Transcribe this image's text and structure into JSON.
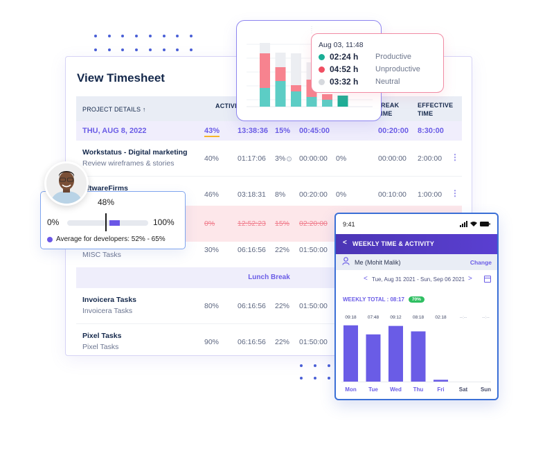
{
  "timesheet": {
    "title": "View Timesheet",
    "headers": {
      "project_details": "PROJECT DETAILS ↑",
      "activity": "ACTIVI",
      "break_time_line1": "REAK",
      "break_time_line2": "IME",
      "effective_line1": "EFFECTIVE",
      "effective_line2": "TIME"
    },
    "date_row": {
      "date": "THU, AUG 8, 2022",
      "activity": "43%",
      "time": "13:38:36",
      "pct": "15%",
      "idle": "00:45:00",
      "break": "00:20:00",
      "effective": "8:30:00"
    },
    "rows": [
      {
        "name": "Workstatus - Digital marketing",
        "sub": "Review wireframes & stories",
        "activity": "40%",
        "time": "01:17:06",
        "pct": "3%",
        "idle": "00:00:00",
        "pct2": "0%",
        "break": "00:00:00",
        "effective": "2:00:00",
        "info": true
      },
      {
        "name": "oftwareFirms",
        "sub": "",
        "activity": "46%",
        "time": "03:18:31",
        "pct": "8%",
        "idle": "00:20:00",
        "pct2": "0%",
        "break": "00:10:00",
        "effective": "1:00:00"
      },
      {
        "name": "",
        "sub": "",
        "activity": "0%",
        "time": "12:52:23",
        "pct": "15%",
        "idle": "02:20:00",
        "deleted": true
      },
      {
        "name": "MISC Tasks",
        "sub": "MISC Tasks",
        "activity": "30%",
        "time": "06:16:56",
        "pct": "22%",
        "idle": "01:50:00"
      },
      {
        "name": "Invoicera Tasks",
        "sub": "Invoicera Tasks",
        "activity": "80%",
        "time": "06:16:56",
        "pct": "22%",
        "idle": "01:50:00"
      },
      {
        "name": "Pixel Tasks",
        "sub": "Pixel Tasks",
        "activity": "90%",
        "time": "06:16:56",
        "pct": "22%",
        "idle": "01:50:00"
      }
    ],
    "lunch_break": "Lunch Break",
    "kebab": "⋮"
  },
  "activity_chart": {
    "colors": {
      "productive": "#5ccdc5",
      "unproductive": "#f7838f",
      "neutral": "#eceef2",
      "highlight": "#1aae96"
    },
    "bars": [
      {
        "productive": 27,
        "unproductive": 50,
        "neutral": 15
      },
      {
        "productive": 37,
        "unproductive": 20,
        "neutral": 21
      },
      {
        "productive": 22,
        "unproductive": 9,
        "neutral": 46
      },
      {
        "productive": 14,
        "unproductive": 25,
        "neutral": 25
      },
      {
        "productive": 10,
        "unproductive": 8,
        "neutral": 0
      },
      {
        "productive": 16,
        "unproductive": 0,
        "neutral": 0,
        "highlighted": true
      }
    ]
  },
  "tooltip": {
    "date": "Aug 03, 11:48",
    "items": [
      {
        "value": "02:24 h",
        "label": "Productive",
        "color": "#1aae96"
      },
      {
        "value": "04:52 h",
        "label": "Unproductive",
        "color": "#f04f62"
      },
      {
        "value": "03:32 h",
        "label": "Neutral",
        "color": "#d6d9de"
      }
    ]
  },
  "developer": {
    "current": "48%",
    "current_value": 48,
    "min_label": "0%",
    "max_label": "100%",
    "range_low": 52,
    "range_high": 65,
    "note": "Average for developers: 52% - 65%"
  },
  "phone": {
    "time": "9:41",
    "status_icons": "▂▄▆ ◔ ▬",
    "back": "<",
    "title": "WEEKLY TIME & ACTIVITY",
    "user": "Me (Mohit Malik)",
    "change": "Change",
    "prev": "<",
    "next": ">",
    "date_range": "Tue, Aug 31 2021 - Sun, Sep 06 2021",
    "weekly_total_label": "WEEKLY TOTAL : 08:17",
    "weekly_badge": "70%",
    "chart_data": {
      "type": "bar",
      "categories": [
        "Mon",
        "Tue",
        "Wed",
        "Thu",
        "Fri",
        "Sat",
        "Sun"
      ],
      "values_hours": [
        9.3,
        7.8,
        9.2,
        8.3,
        0.3,
        0,
        0
      ],
      "labels": [
        "09:18",
        "07:48",
        "09:12",
        "08:18",
        "02:18",
        "--:--",
        "--:--"
      ],
      "bar_color": "#6a5ce6",
      "ymax": 9.5
    }
  }
}
